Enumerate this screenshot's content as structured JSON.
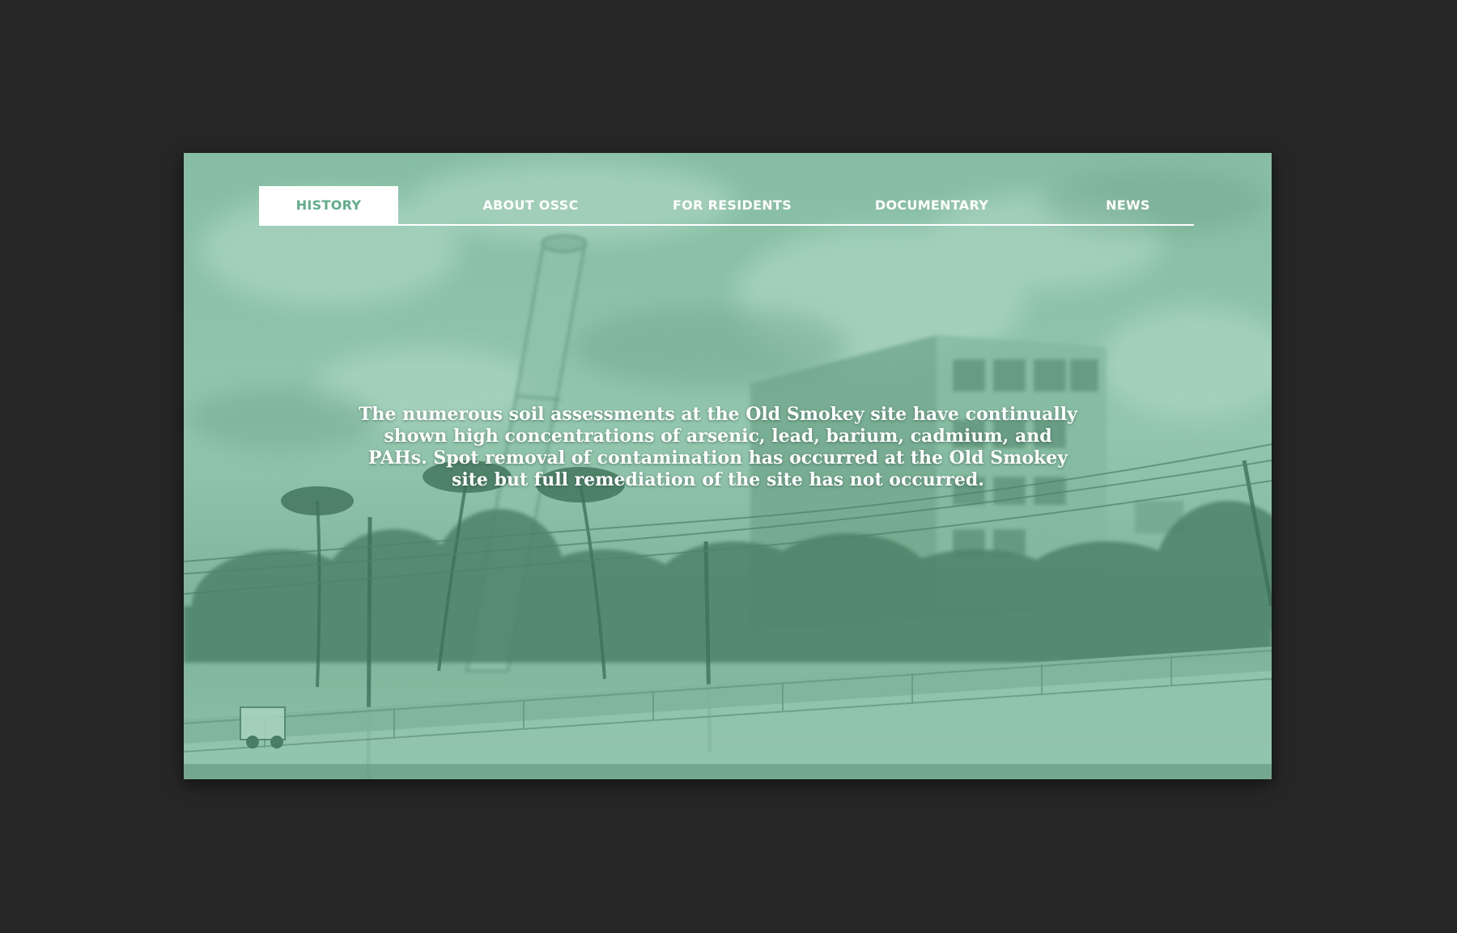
{
  "nav": {
    "items": [
      {
        "label": "HISTORY",
        "active": true
      },
      {
        "label": "ABOUT OSSC",
        "active": false
      },
      {
        "label": "FOR RESIDENTS",
        "active": false
      },
      {
        "label": "DOCUMENTARY",
        "active": false
      },
      {
        "label": "NEWS",
        "active": false
      }
    ]
  },
  "hero": {
    "text": "The numerous soil assessments at the Old Smokey site have continually shown high concentrations of arsenic, lead, barium, cadmium, and PAHs. Spot removal of contamination has occurred at the Old Smokey site but full remediation of the site has not occurred."
  },
  "colors": {
    "page_background": "#262626",
    "photo_tint": "#7fb89e",
    "accent_green": "#5fae8b",
    "nav_text": "#ffffff"
  }
}
